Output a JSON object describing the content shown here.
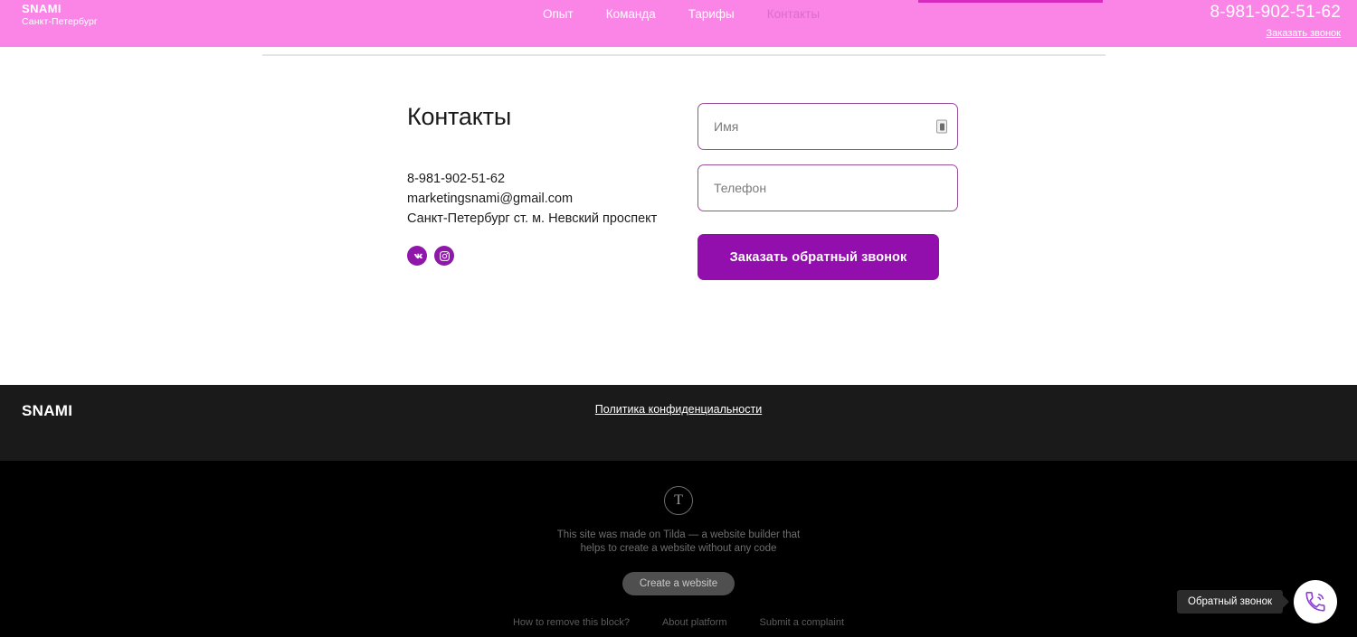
{
  "header": {
    "logo_title": "SNAMI",
    "logo_subtitle": "Санкт-Петербург",
    "nav": [
      {
        "label": "Опыт",
        "active": false
      },
      {
        "label": "Команда",
        "active": false
      },
      {
        "label": "Тарифы",
        "active": false
      },
      {
        "label": "Контакты",
        "active": true
      }
    ],
    "phone": "8-981-902-51-62",
    "callback_link": "Заказать звонок",
    "background_color": "#fa85e7",
    "accent_bar_color": "#d62bbd"
  },
  "contacts": {
    "heading": "Контакты",
    "phone": "8-981-902-51-62",
    "email": "marketingsnami@gmail.com",
    "address": "Санкт-Петербург ст. м. Невский проспект",
    "socials": [
      {
        "name": "vk-icon",
        "label": "VK"
      },
      {
        "name": "instagram-icon",
        "label": "Instagram"
      }
    ],
    "social_color": "#8f18ab"
  },
  "form": {
    "name_placeholder": "Имя",
    "name_value": "",
    "phone_placeholder": "Телефон",
    "phone_value": "",
    "submit_label": "Заказать обратный звонок",
    "submit_color": "#920ead",
    "border_color": "#9b4f9b"
  },
  "footer": {
    "logo": "SNAMI",
    "policy_link": "Политика конфиденциальности",
    "background_color": "#1a1a1a"
  },
  "tilda": {
    "logo_glyph": "T",
    "text_line1": "This site was made on Tilda — a website builder that",
    "text_line2": "helps to create a website without any code",
    "cta_label": "Create a website",
    "links": [
      "How to remove this block?",
      "About platform",
      "Submit a complaint"
    ]
  },
  "callback_widget": {
    "tooltip": "Обратный звонок",
    "icon": "phone-ring-icon",
    "icon_color": "#8b3fd4"
  }
}
